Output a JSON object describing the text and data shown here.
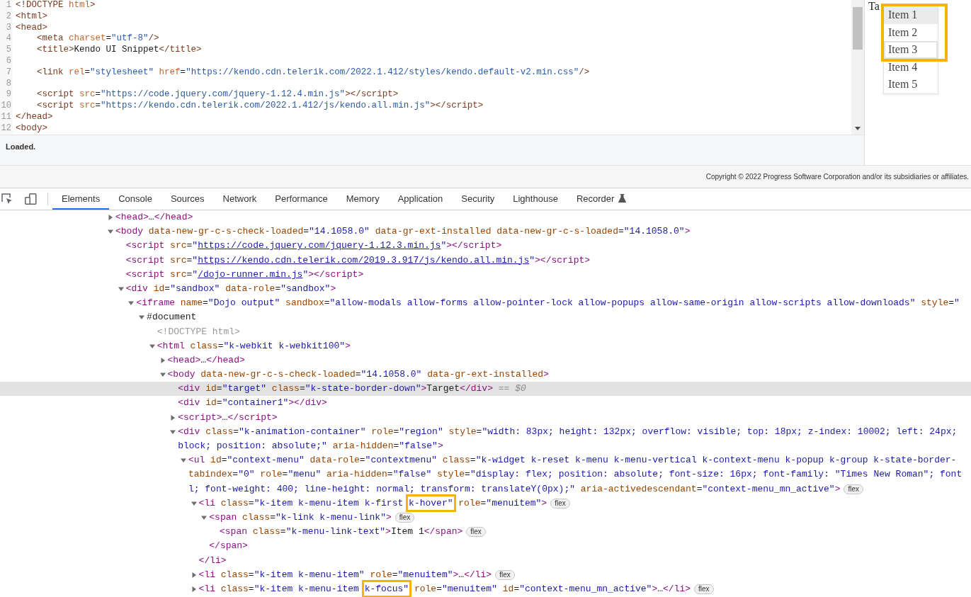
{
  "editor": {
    "lines": [
      {
        "number": "1",
        "code": "<!DOCTYPE html>"
      },
      {
        "number": "2",
        "code": "<html>"
      },
      {
        "number": "3",
        "code": "<head>"
      },
      {
        "number": "4",
        "code": "    <meta charset=\"utf-8\"/>"
      },
      {
        "number": "5",
        "code": "    <title>Kendo UI Snippet</title>"
      },
      {
        "number": "6"
      },
      {
        "number": "7",
        "code": "    <link rel=\"stylesheet\" href=\"https://kendo.cdn.telerik.com/2022.1.412/styles/kendo.default-v2.min.css\"/>"
      },
      {
        "number": "8"
      },
      {
        "number": "9",
        "code": "    <script src=\"https://code.jquery.com/jquery-1.12.4.min.js\"></script>"
      },
      {
        "number": "10",
        "code": "    <script src=\"https://kendo.cdn.telerik.com/2022.1.412/js/kendo.all.min.js\"></script>"
      },
      {
        "number": "11",
        "code": "</head>"
      },
      {
        "number": "12",
        "code": "<body>"
      }
    ],
    "status": "Loaded."
  },
  "preview": {
    "target": "Ta",
    "menu": [
      {
        "label": "Item 1",
        "hover": true,
        "focus": false,
        "annotated": true
      },
      {
        "label": "Item 2",
        "hover": false,
        "focus": false,
        "annotated": true
      },
      {
        "label": "Item 3",
        "hover": false,
        "focus": true,
        "annotated": true
      },
      {
        "label": "Item 4",
        "hover": false,
        "focus": false,
        "annotated": false
      },
      {
        "label": "Item 5",
        "hover": false,
        "focus": false,
        "annotated": false
      }
    ]
  },
  "footer": {
    "copyright": "Copyright © 2022 Progress Software Corporation and/or its subsidiaries or affiliates."
  },
  "devtools": {
    "tabs": [
      {
        "label": "Elements",
        "selected": true,
        "kind": "standard"
      },
      {
        "label": "Console",
        "selected": false,
        "kind": "standard"
      },
      {
        "label": "Sources",
        "selected": false,
        "kind": "standard"
      },
      {
        "label": "Network",
        "selected": false,
        "kind": "standard"
      },
      {
        "label": "Performance",
        "selected": false,
        "kind": "standard"
      },
      {
        "label": "Memory",
        "selected": false,
        "kind": "standard"
      },
      {
        "label": "Application",
        "selected": false,
        "kind": "standard"
      },
      {
        "label": "Security",
        "selected": false,
        "kind": "standard"
      },
      {
        "label": "Lighthouse",
        "selected": false,
        "kind": "standard"
      },
      {
        "label": "Recorder",
        "selected": false,
        "kind": "experimental"
      }
    ],
    "elements_tree": [
      {
        "kind": "branch",
        "expanded": false,
        "selected": false,
        "text": "<head>…</head>"
      },
      {
        "kind": "branch",
        "expanded": true,
        "selected": false,
        "text": "<body data-new-gr-c-s-check-loaded=\"14.1058.0\" data-gr-ext-installed data-new-gr-c-s-loaded=\"14.1058.0\">",
        "children": [
          {
            "kind": "leaf",
            "selected": false,
            "lines": [
              [
                {
                  "kind": "code",
                  "text": "<script src=\""
                },
                {
                  "kind": "link",
                  "text": "https://code.jquery.com/jquery-1.12.3.min.js"
                },
                {
                  "kind": "code",
                  "text": "\"></script>"
                }
              ]
            ]
          },
          {
            "kind": "leaf",
            "selected": false,
            "lines": [
              [
                {
                  "kind": "code",
                  "text": "<script src=\""
                },
                {
                  "kind": "link",
                  "text": "https://kendo.cdn.telerik.com/2019.3.917/js/kendo.all.min.js"
                },
                {
                  "kind": "code",
                  "text": "\"></script>"
                }
              ]
            ]
          },
          {
            "kind": "leaf",
            "selected": false,
            "lines": [
              [
                {
                  "kind": "code",
                  "text": "<script src=\""
                },
                {
                  "kind": "link",
                  "text": "/dojo-runner.min.js"
                },
                {
                  "kind": "code",
                  "text": "\"></script>"
                }
              ]
            ]
          },
          {
            "kind": "branch",
            "expanded": true,
            "selected": false,
            "text": "<div id=\"sandbox\" data-role=\"sandbox\">",
            "children": [
              {
                "kind": "branch",
                "expanded": true,
                "selected": false,
                "text": "<iframe name=\"Dojo output\" sandbox=\"allow-modals allow-forms allow-pointer-lock allow-popups allow-same-origin allow-scripts allow-downloads\" style=\"",
                "children": [
                  {
                    "kind": "branch",
                    "expanded": true,
                    "selected": false,
                    "text": "#document",
                    "children": [
                      {
                        "kind": "doctype",
                        "selected": false,
                        "text": "<!DOCTYPE html>"
                      },
                      {
                        "kind": "branch",
                        "expanded": true,
                        "selected": false,
                        "text": "<html class=\"k-webkit k-webkit100\">",
                        "children": [
                          {
                            "kind": "branch",
                            "expanded": false,
                            "selected": false,
                            "text": "<head>…</head>"
                          },
                          {
                            "kind": "branch",
                            "expanded": true,
                            "selected": false,
                            "text": "<body data-new-gr-c-s-check-loaded=\"14.1058.0\" data-gr-ext-installed>",
                            "children": [
                              {
                                "kind": "leaf",
                                "selected": true,
                                "lines": [
                                  [
                                    {
                                      "kind": "code",
                                      "text": "<div id=\"target\" class=\"k-state-border-down\">Target</div>"
                                    },
                                    {
                                      "kind": "note",
                                      "text": "== $0"
                                    }
                                  ]
                                ]
                              },
                              {
                                "kind": "leaf",
                                "selected": false,
                                "text": "<div id=\"container1\"></div>"
                              },
                              {
                                "kind": "branch",
                                "expanded": false,
                                "selected": false,
                                "text": "<script>…</script>"
                              },
                              {
                                "kind": "branch",
                                "expanded": true,
                                "selected": false,
                                "lines": [
                                  [
                                    {
                                      "kind": "code",
                                      "text": "<div class=\"k-animation-container\" role=\"region\" style=\"width: 83px; height: 132px; overflow: visible; top: 18px; z-index: 10002; left: 24px;"
                                    }
                                  ],
                                  [
                                    {
                                      "kind": "code",
                                      "text": "block; position: absolute;\" aria-hidden=\"false\">"
                                    }
                                  ]
                                ],
                                "children": [
                                  {
                                    "kind": "branch",
                                    "expanded": true,
                                    "selected": false,
                                    "badge": "flex",
                                    "lines": [
                                      [
                                        {
                                          "kind": "code",
                                          "text": "<ul id=\"context-menu\" data-role=\"contextmenu\" class=\"k-widget k-reset k-menu k-menu-vertical k-context-menu k-popup k-group k-state-border-"
                                        }
                                      ],
                                      [
                                        {
                                          "kind": "code",
                                          "text": "tabindex=\"0\" role=\"menu\" aria-hidden=\"false\" style=\"display: flex; position: absolute; font-size: 16px; font-family: \"Times New Roman\"; font"
                                        }
                                      ],
                                      [
                                        {
                                          "kind": "code",
                                          "text": "l; font-weight: 400; line-height: normal; transform: translateY(0px);\" aria-activedescendant=\"context-menu_mn_active\">"
                                        }
                                      ]
                                    ],
                                    "children": [
                                      {
                                        "kind": "branch",
                                        "expanded": true,
                                        "selected": false,
                                        "badge": "flex",
                                        "closing": "</li>",
                                        "lines": [
                                          [
                                            {
                                              "kind": "code",
                                              "text": "<li class=\"k-item k-menu-item k-first "
                                            },
                                            {
                                              "kind": "highlight",
                                              "text": "k-hover\""
                                            },
                                            {
                                              "kind": "code",
                                              "text": " role=\"menuitem\">"
                                            }
                                          ]
                                        ],
                                        "children": [
                                          {
                                            "kind": "branch",
                                            "expanded": true,
                                            "selected": false,
                                            "badge": "flex",
                                            "closing": "</span>",
                                            "text": "<span class=\"k-link k-menu-link\">",
                                            "children": [
                                              {
                                                "kind": "leaf",
                                                "selected": false,
                                                "badge": "flex",
                                                "text": "<span class=\"k-menu-link-text\">Item 1</span>"
                                              }
                                            ]
                                          }
                                        ]
                                      },
                                      {
                                        "kind": "branch",
                                        "expanded": false,
                                        "selected": false,
                                        "badge": "flex",
                                        "text": "<li class=\"k-item k-menu-item\" role=\"menuitem\">…</li>"
                                      },
                                      {
                                        "kind": "branch",
                                        "expanded": false,
                                        "selected": false,
                                        "badge": "flex",
                                        "lines": [
                                          [
                                            {
                                              "kind": "code",
                                              "text": "<li class=\"k-item k-menu-item "
                                            },
                                            {
                                              "kind": "highlight",
                                              "text": "k-focus\""
                                            },
                                            {
                                              "kind": "code",
                                              "text": " role=\"menuitem\" id=\"context-menu_mn_active\">…</li>"
                                            }
                                          ]
                                        ]
                                      }
                                    ]
                                  }
                                ]
                              }
                            ]
                          }
                        ]
                      }
                    ]
                  }
                ]
              }
            ]
          }
        ]
      }
    ]
  }
}
